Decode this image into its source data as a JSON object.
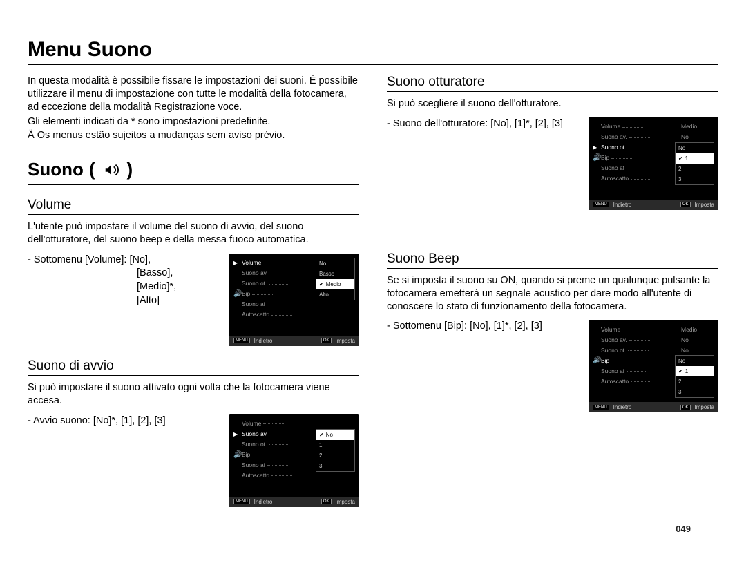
{
  "page_title": "Menu Suono",
  "page_number": "049",
  "intro": {
    "p1": "In questa modalità è possibile fissare le impostazioni dei suoni. È possibile utilizzare il menu di impostazione con tutte le modalità della fotocamera, ad eccezione della modalità Registrazione voce.",
    "bullet": "Gli elementi indicati da * sono impostazioni predefinite.",
    "note": "Ä Os menus estão sujeitos a mudanças sem aviso prévio."
  },
  "sound_section_title": "Suono",
  "volume": {
    "heading": "Volume",
    "text": "L'utente può impostare il volume del suono di avvio, del suono dell'otturatore, del suono beep e della messa fuoco automatica.",
    "submenu_label": "-  Sottomenu [Volume]: [No],",
    "submenu_rest": "[Basso],\n[Medio]*,\n[Alto]"
  },
  "startup": {
    "heading": "Suono di avvio",
    "text": "Si può impostare il suono attivato ogni volta che la fotocamera viene accesa.",
    "submenu": "-  Avvio suono: [No]*, [1], [2], [3]"
  },
  "shutter": {
    "heading": "Suono otturatore",
    "text": "Si può scegliere il suono dell'otturatore.",
    "submenu": "-  Suono dell'otturatore: [No], [1]*, [2], [3]"
  },
  "beep": {
    "heading": "Suono Beep",
    "text": "Se si imposta il suono su ON, quando si preme un qualunque pulsante la fotocamera emetterà un segnale acustico per dare modo all'utente di conoscere lo stato di funzionamento della fotocamera.",
    "submenu": "-  Sottomenu [Bip]: [No], [1]*, [2], [3]"
  },
  "lcd_common": {
    "items": [
      "Volume",
      "Suono av.",
      "Suono ot.",
      "Bip",
      "Suono af",
      "Autoscatto"
    ],
    "footer_back_tag": "MENU",
    "footer_back": "Indietro",
    "footer_set_tag": "OK",
    "footer_set": "Imposta"
  },
  "lcd_volume": {
    "highlight_index": 0,
    "right_value": "",
    "options": [
      "No",
      "Basso",
      "Medio",
      "Alto"
    ],
    "selected": "Medio"
  },
  "lcd_startup": {
    "highlight_index": 1,
    "right_value": "",
    "options": [
      "No",
      "1",
      "2",
      "3"
    ],
    "selected": "No"
  },
  "lcd_shutter": {
    "highlight_index": 2,
    "right_values": {
      "0": "Medio",
      "1": "No"
    },
    "options": [
      "No",
      "1",
      "2",
      "3"
    ],
    "selected": "1"
  },
  "lcd_beep": {
    "highlight_index": 3,
    "right_values": {
      "0": "Medio",
      "1": "No",
      "2": "No"
    },
    "options": [
      "No",
      "1",
      "2",
      "3"
    ],
    "selected": "1"
  }
}
